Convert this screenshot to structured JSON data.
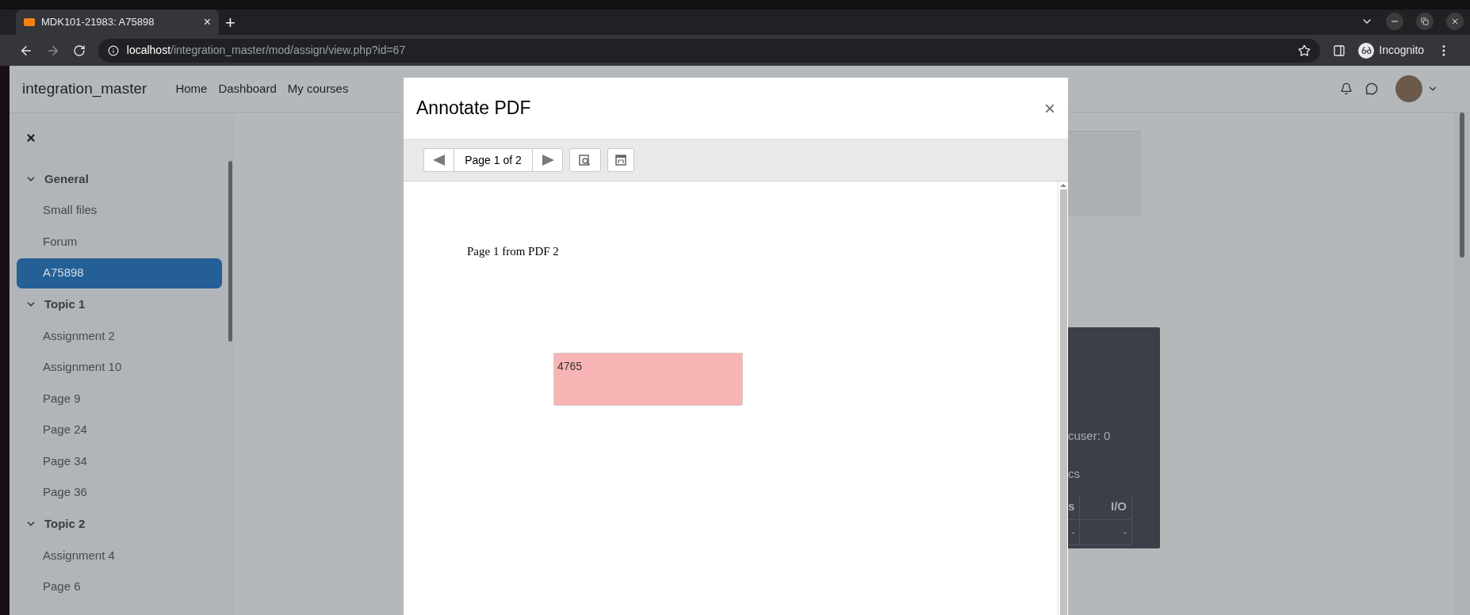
{
  "browser": {
    "tab": {
      "title": "MDK101-21983: A75898",
      "close": "×"
    },
    "new_tab": "+",
    "url": {
      "host": "localhost",
      "path": "/integration_master/mod/assign/view.php?id=67"
    },
    "profile": "Incognito"
  },
  "site": {
    "name": "integration_master",
    "nav": [
      "Home",
      "Dashboard",
      "My courses"
    ]
  },
  "sidebar": {
    "sections": [
      {
        "title": "General",
        "expanded": true,
        "items": [
          {
            "label": "Small files",
            "selected": false
          },
          {
            "label": "Forum",
            "selected": false
          },
          {
            "label": "A75898",
            "selected": true
          }
        ]
      },
      {
        "title": "Topic 1",
        "expanded": true,
        "items": [
          {
            "label": "Assignment 2",
            "selected": false
          },
          {
            "label": "Assignment 10",
            "selected": false
          },
          {
            "label": "Page 9",
            "selected": false
          },
          {
            "label": "Page 24",
            "selected": false
          },
          {
            "label": "Page 34",
            "selected": false
          },
          {
            "label": "Page 36",
            "selected": false
          }
        ]
      },
      {
        "title": "Topic 2",
        "expanded": true,
        "items": [
          {
            "label": "Assignment 4",
            "selected": false
          },
          {
            "label": "Page 6",
            "selected": false
          }
        ]
      }
    ]
  },
  "background_panel": {
    "lines": [
      "cuser: 0",
      "cs"
    ],
    "table": {
      "columns": [
        "s",
        "I/O"
      ],
      "rows": [
        [
          "-",
          "-"
        ]
      ]
    }
  },
  "modal": {
    "title": "Annotate PDF",
    "close": "×",
    "page_label": "Page 1 of 2",
    "pdf_text": "Page 1 from PDF 2",
    "comment": {
      "text": "4765"
    }
  }
}
